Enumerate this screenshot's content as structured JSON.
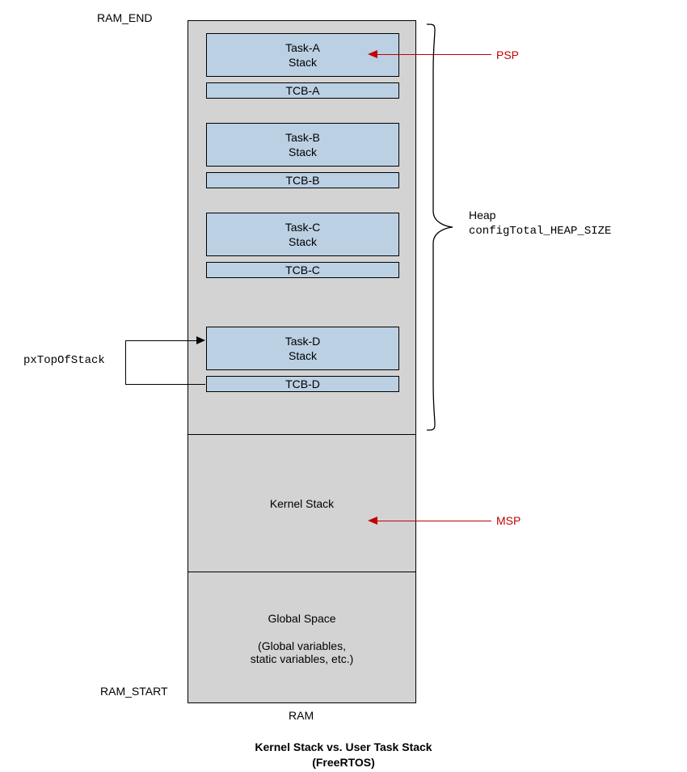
{
  "labels": {
    "ram_end": "RAM_END",
    "ram_start": "RAM_START",
    "ram": "RAM",
    "psp": "PSP",
    "msp": "MSP",
    "heap_line1": "Heap",
    "heap_line2": "configTotal_HEAP_SIZE",
    "pxtop": "pxTopOfStack"
  },
  "blocks": {
    "task_a_l1": "Task-A",
    "task_a_l2": "Stack",
    "tcb_a": "TCB-A",
    "task_b_l1": "Task-B",
    "task_b_l2": "Stack",
    "tcb_b": "TCB-B",
    "task_c_l1": "Task-C",
    "task_c_l2": "Stack",
    "tcb_c": "TCB-C",
    "task_d_l1": "Task-D",
    "task_d_l2": "Stack",
    "tcb_d": "TCB-D",
    "kernel": "Kernel Stack",
    "global_l1": "Global Space",
    "global_l2": "(Global variables,",
    "global_l3": "static variables, etc.)"
  },
  "title": {
    "l1": "Kernel Stack vs. User Task Stack",
    "l2": "(FreeRTOS)"
  }
}
